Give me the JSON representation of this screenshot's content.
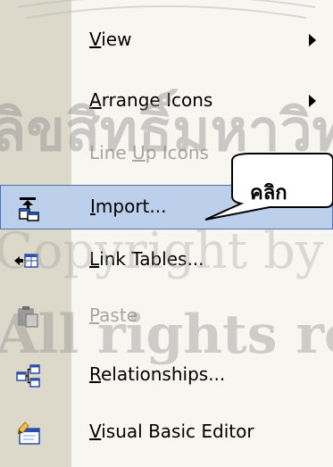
{
  "menu": {
    "items": [
      {
        "label": "View",
        "mnemonic": "V",
        "rest": "iew",
        "submenu": true,
        "enabled": true,
        "icon": ""
      },
      {
        "label": "Arrange Icons",
        "mnemonic": "A",
        "rest": "rrange Icons",
        "submenu": true,
        "enabled": true,
        "icon": ""
      },
      {
        "label": "Line Up Icons",
        "pre": "Line ",
        "mnemonic": "U",
        "rest": "p Icons",
        "submenu": false,
        "enabled": false,
        "icon": ""
      },
      {
        "label": "Import...",
        "mnemonic": "I",
        "rest": "mport...",
        "submenu": false,
        "enabled": true,
        "highlighted": true,
        "icon": "import-icon"
      },
      {
        "label": "Link Tables...",
        "mnemonic": "L",
        "rest": "ink Tables...",
        "submenu": false,
        "enabled": true,
        "icon": "link-tables-icon"
      },
      {
        "label": "Paste",
        "mnemonic": "P",
        "rest": "aste",
        "submenu": false,
        "enabled": false,
        "icon": "paste-icon"
      },
      {
        "label": "Relationships...",
        "mnemonic": "R",
        "rest": "elationships...",
        "submenu": false,
        "enabled": true,
        "icon": "relationships-icon"
      },
      {
        "label": "Visual Basic Editor",
        "mnemonic": "V",
        "rest": "isual Basic Editor",
        "submenu": false,
        "enabled": true,
        "icon": "visual-basic-editor-icon"
      }
    ]
  },
  "callout": {
    "text": "คลิก"
  },
  "colors": {
    "icon_strip": "#dcd8ca",
    "menu_bg": "#f7f6f1",
    "highlight_bg": "#bcd0ec",
    "highlight_border": "#5470a8",
    "disabled_text": "#a8a59a"
  },
  "watermark": {
    "line1": "ลิขสิทธิ์มหาวิทยาลัยเชียงใหม่",
    "line2": "Copyright by Chiang Mai University",
    "line3": "All rights reserved"
  }
}
